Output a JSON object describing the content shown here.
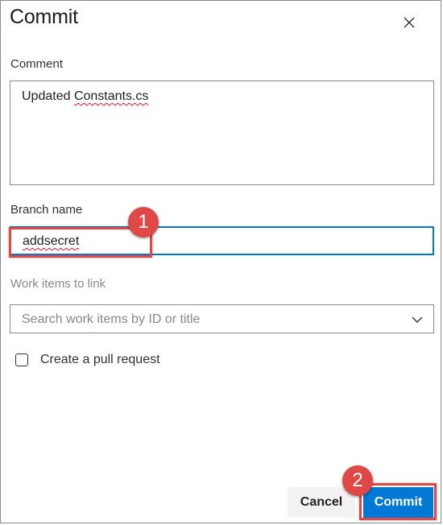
{
  "dialog": {
    "title": "Commit",
    "close_icon": "close-icon"
  },
  "comment": {
    "label": "Comment",
    "value_prefix": "Updated ",
    "value_flagged": "Constants.cs"
  },
  "branch": {
    "label": "Branch name",
    "value": "addsecret"
  },
  "work_items": {
    "label": "Work items to link",
    "placeholder": "Search work items by ID or title",
    "dropdown_icon": "chevron-down-icon"
  },
  "pull_request": {
    "label": "Create a pull request",
    "checked": false
  },
  "buttons": {
    "cancel": "Cancel",
    "commit": "Commit"
  },
  "annotations": {
    "step1": "1",
    "step2": "2"
  },
  "colors": {
    "primary": "#0078d4",
    "annotation_red": "#e04848",
    "border": "#8a8a8a"
  }
}
